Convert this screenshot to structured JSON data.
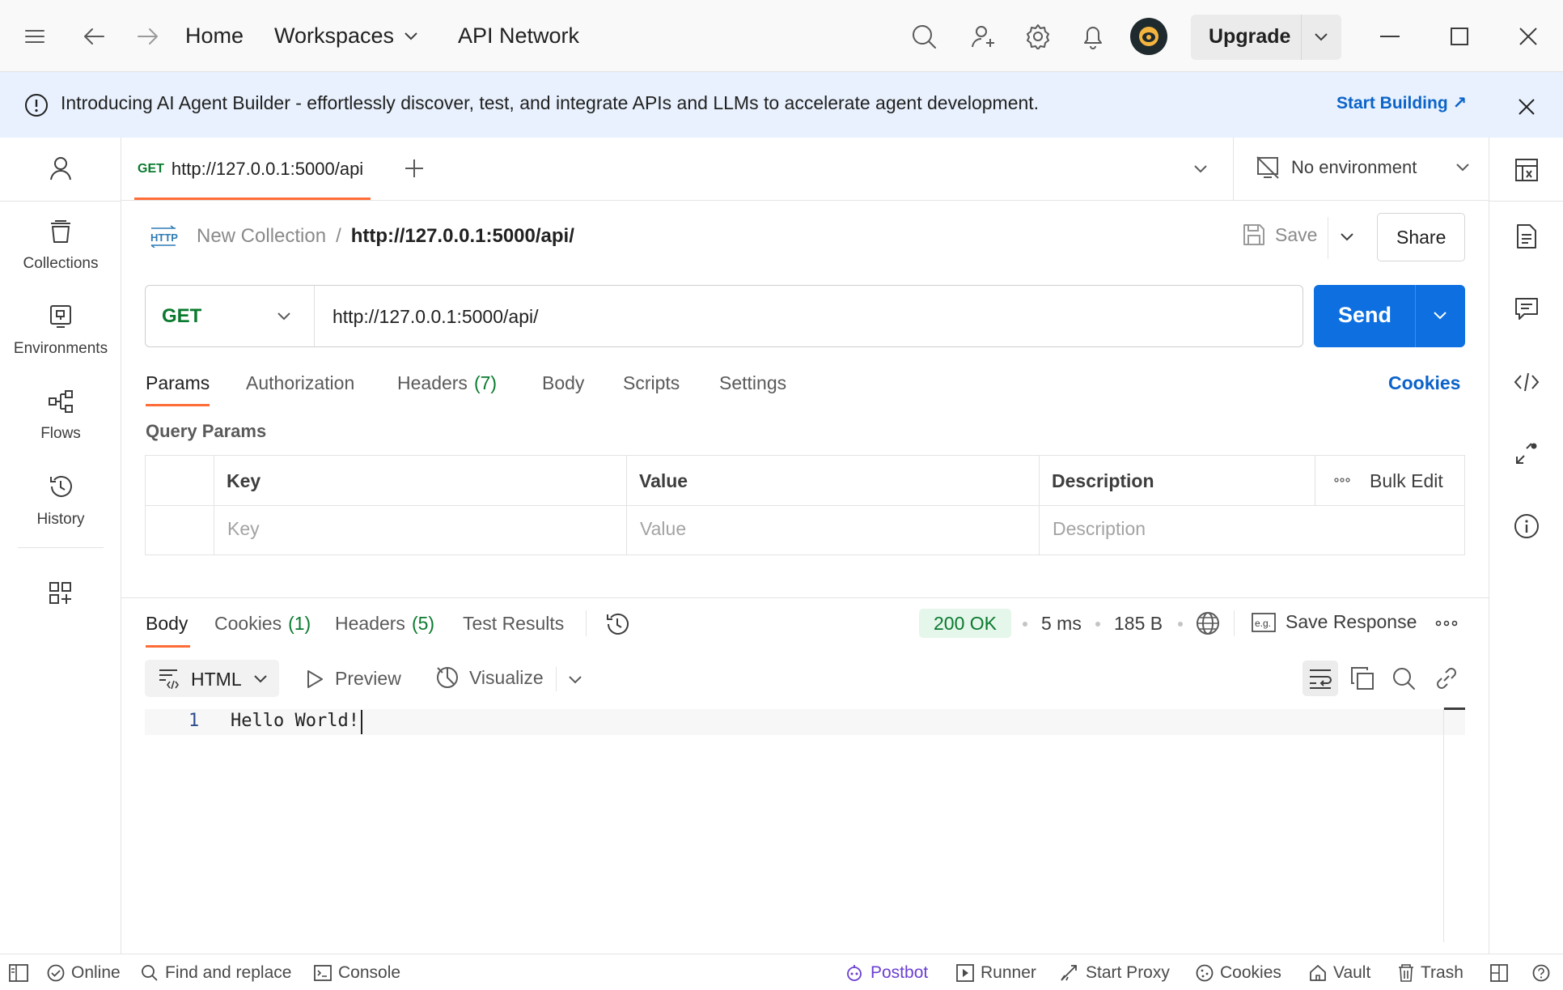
{
  "titlebar": {
    "nav": {
      "home": "Home",
      "workspaces": "Workspaces",
      "api_network": "API Network"
    },
    "upgrade_label": "Upgrade"
  },
  "banner": {
    "message": "Introducing AI Agent Builder - effortlessly discover, test, and integrate APIs and LLMs to accelerate agent development.",
    "cta": "Start Building ↗"
  },
  "sidebar": {
    "items": [
      {
        "label": "Collections",
        "icon": "trash-bin-icon"
      },
      {
        "label": "Environments",
        "icon": "environment-icon"
      },
      {
        "label": "Flows",
        "icon": "flows-icon"
      },
      {
        "label": "History",
        "icon": "history-icon"
      }
    ]
  },
  "tabs": {
    "items": [
      {
        "method": "GET",
        "title": "http://127.0.0.1:5000/api"
      }
    ],
    "environment": "No environment"
  },
  "request": {
    "breadcrumb": {
      "collection": "New Collection",
      "separator": "/",
      "name": "http://127.0.0.1:5000/api/"
    },
    "save_label": "Save",
    "share_label": "Share",
    "method": "GET",
    "url": "http://127.0.0.1:5000/api/",
    "send_label": "Send",
    "subtabs": {
      "params": "Params",
      "authorization": "Authorization",
      "headers": "Headers",
      "headers_count": "(7)",
      "body": "Body",
      "scripts": "Scripts",
      "settings": "Settings",
      "cookies": "Cookies"
    },
    "query_params": {
      "title": "Query Params",
      "columns": {
        "key": "Key",
        "value": "Value",
        "description": "Description"
      },
      "bulk_edit": "Bulk Edit",
      "placeholders": {
        "key": "Key",
        "value": "Value",
        "description": "Description"
      }
    }
  },
  "response": {
    "tabs": {
      "body": "Body",
      "cookies": "Cookies",
      "cookies_count": "(1)",
      "headers": "Headers",
      "headers_count": "(5)",
      "test_results": "Test Results"
    },
    "status": "200 OK",
    "time": "5 ms",
    "size": "185 B",
    "save_response": "Save Response",
    "format": "HTML",
    "preview": "Preview",
    "visualize": "Visualize",
    "lines": [
      {
        "number": "1",
        "text": "Hello World!"
      }
    ]
  },
  "statusbar": {
    "online": "Online",
    "find_replace": "Find and replace",
    "console": "Console",
    "postbot": "Postbot",
    "runner": "Runner",
    "start_proxy": "Start Proxy",
    "cookies": "Cookies",
    "vault": "Vault",
    "trash": "Trash"
  },
  "colors": {
    "accent_blue": "#0d6fe0",
    "tab_underline": "#ff6c37",
    "method_green": "#0a7a2f",
    "banner_bg": "#e8f1fd",
    "postbot_purple": "#6b3fd1"
  }
}
